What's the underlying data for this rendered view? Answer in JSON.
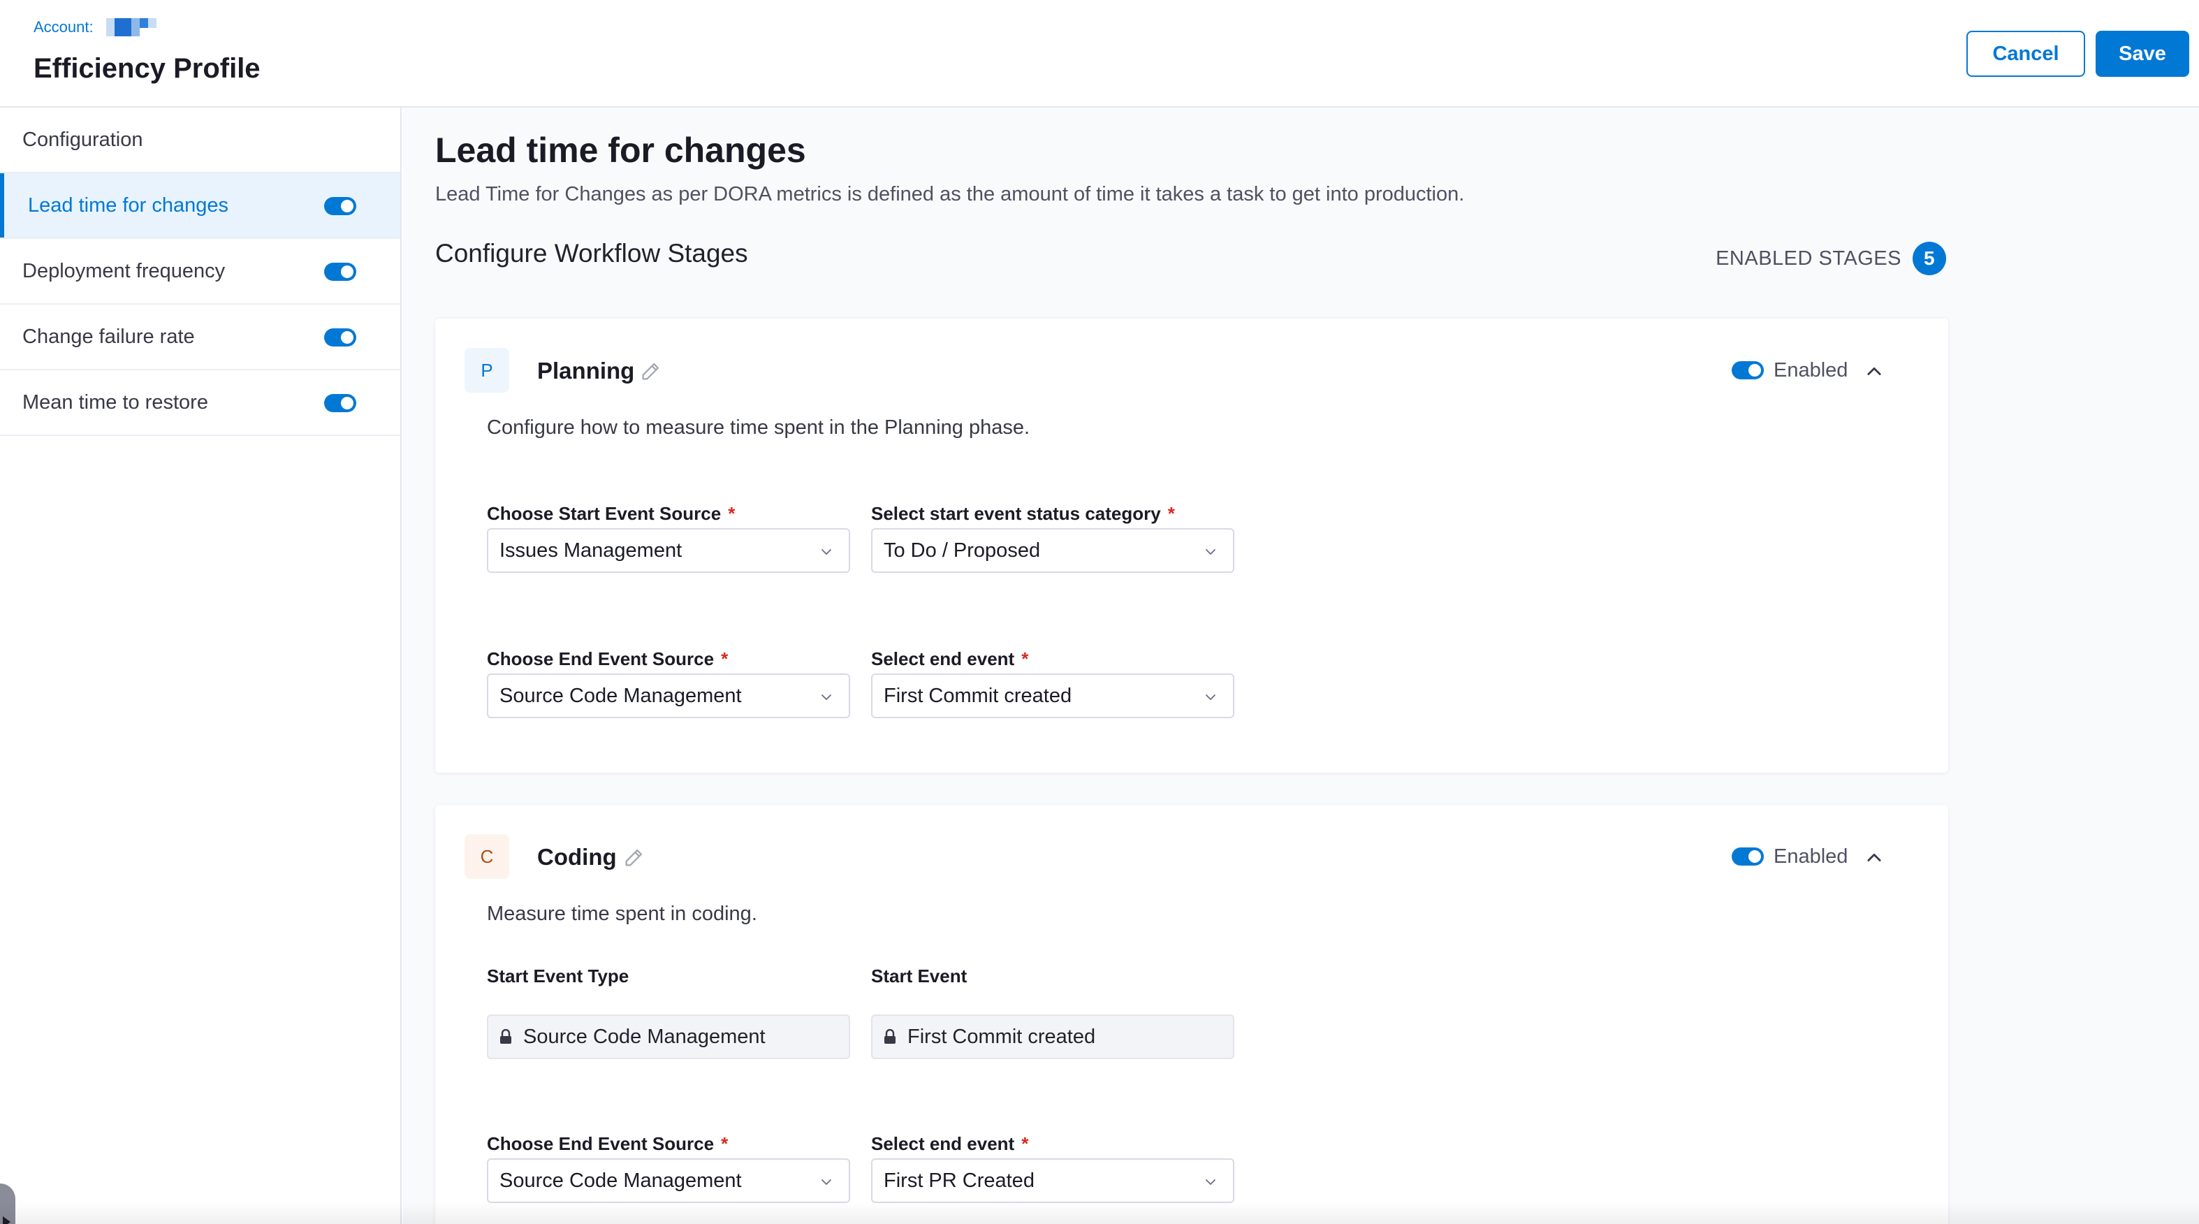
{
  "header": {
    "account_label": "Account:",
    "title": "Efficiency Profile",
    "cancel_label": "Cancel",
    "save_label": "Save"
  },
  "sidebar": {
    "items": [
      {
        "label": "Configuration",
        "active": false,
        "toggle": null
      },
      {
        "label": "Lead time for changes",
        "active": true,
        "toggle": true
      },
      {
        "label": "Deployment frequency",
        "active": false,
        "toggle": true
      },
      {
        "label": "Change failure rate",
        "active": false,
        "toggle": true
      },
      {
        "label": "Mean time to restore",
        "active": false,
        "toggle": true
      }
    ]
  },
  "main": {
    "title": "Lead time for changes",
    "description": "Lead Time for Changes as per DORA metrics is defined as the amount of time it takes a task to get into production.",
    "section_title": "Configure Workflow Stages",
    "enabled_stages_label": "ENABLED STAGES",
    "enabled_stages_count": "5"
  },
  "stages": {
    "planning": {
      "letter": "P",
      "name": "Planning",
      "enabled": true,
      "enabled_label": "Enabled",
      "description": "Configure how to measure time spent in the Planning phase.",
      "start_source_label": "Choose Start Event Source",
      "start_source_value": "Issues Management",
      "start_status_label": "Select start event status category",
      "start_status_value": "To Do / Proposed",
      "end_source_label": "Choose End Event Source",
      "end_source_value": "Source Code Management",
      "end_event_label": "Select end event",
      "end_event_value": "First Commit created"
    },
    "coding": {
      "letter": "C",
      "name": "Coding",
      "enabled": true,
      "enabled_label": "Enabled",
      "description": "Measure time spent in coding.",
      "start_type_label": "Start Event Type",
      "start_type_value": "Source Code Management",
      "start_event_label": "Start Event",
      "start_event_value": "First Commit created",
      "end_source_label": "Choose End Event Source",
      "end_source_value": "Source Code Management",
      "end_event_label": "Select end event",
      "end_event_value": "First PR Created"
    }
  },
  "required_marker": "*",
  "icons": {
    "edit": "pencil-icon",
    "collapse": "chevron-up-icon",
    "dropdown": "chevron-down-icon",
    "lock": "lock-icon",
    "drawer": "drawer-toggle-icon"
  },
  "colors": {
    "primary": "#0278d5",
    "required": "#da291d",
    "active_bg": "#e8f3fd",
    "coding_letter": "#ab4f14"
  }
}
